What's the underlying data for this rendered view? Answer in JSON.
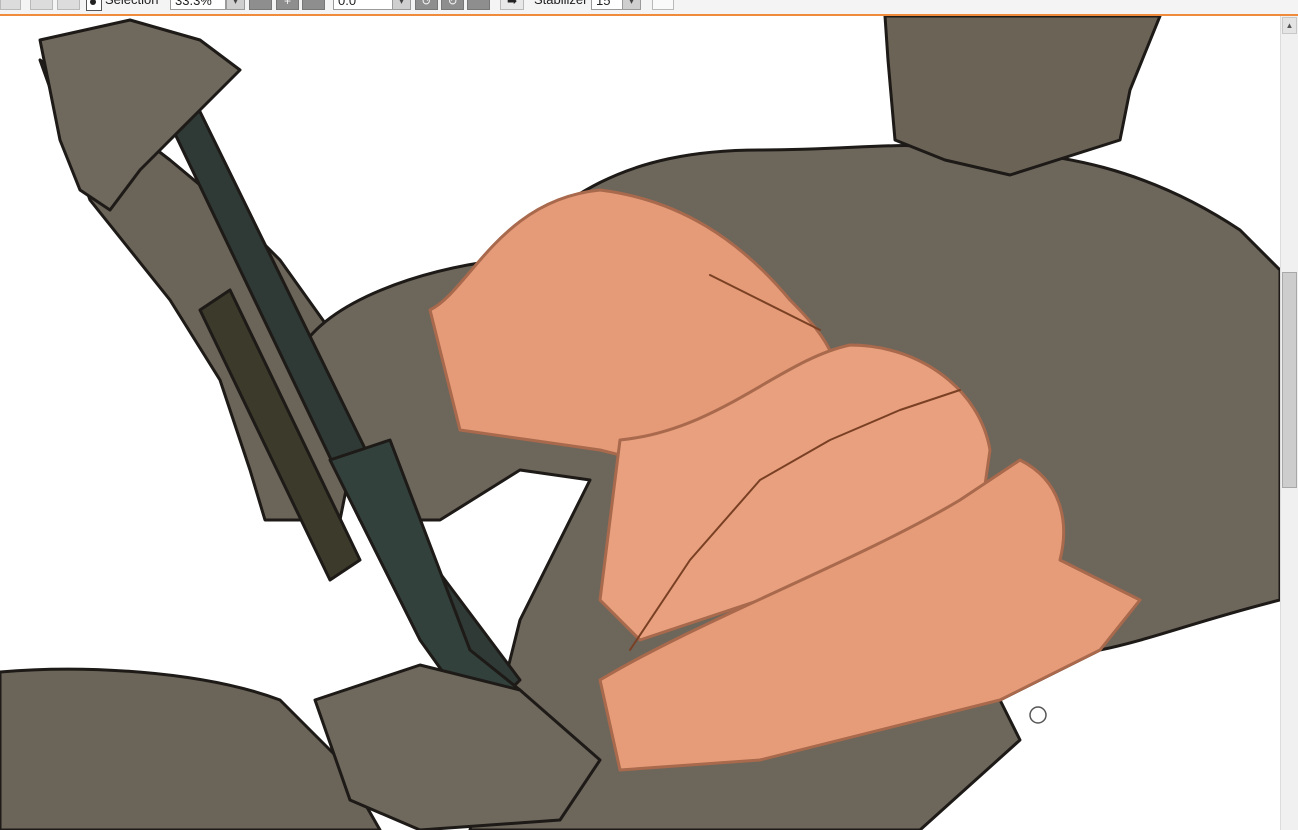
{
  "toolbar": {
    "selection_label": "Selection",
    "zoom_value": "33.3%",
    "angle_value": "0.0",
    "stabilizer_label": "Stabilizer",
    "stabilizer_value": "15",
    "dropdown_glyph": "▾"
  },
  "scrollbar": {
    "up_glyph": "▲"
  },
  "colors": {
    "accent": "#f08a3c",
    "toolbar_bg": "#f4f4f4",
    "skin_flat": "#6d665b",
    "skin_highlight": "#e59a78",
    "rifle_dark": "#2f3a36"
  },
  "icons": [
    "new-icon",
    "back-icon",
    "forward-icon",
    "selection-toggle-icon",
    "zoom-out-icon",
    "zoom-in-icon",
    "fit-icon",
    "rotate-left-icon",
    "rotate-right-icon",
    "rotate-reset-icon",
    "flip-horizontal-icon",
    "cursor-icon",
    "brush-cursor-icon"
  ]
}
